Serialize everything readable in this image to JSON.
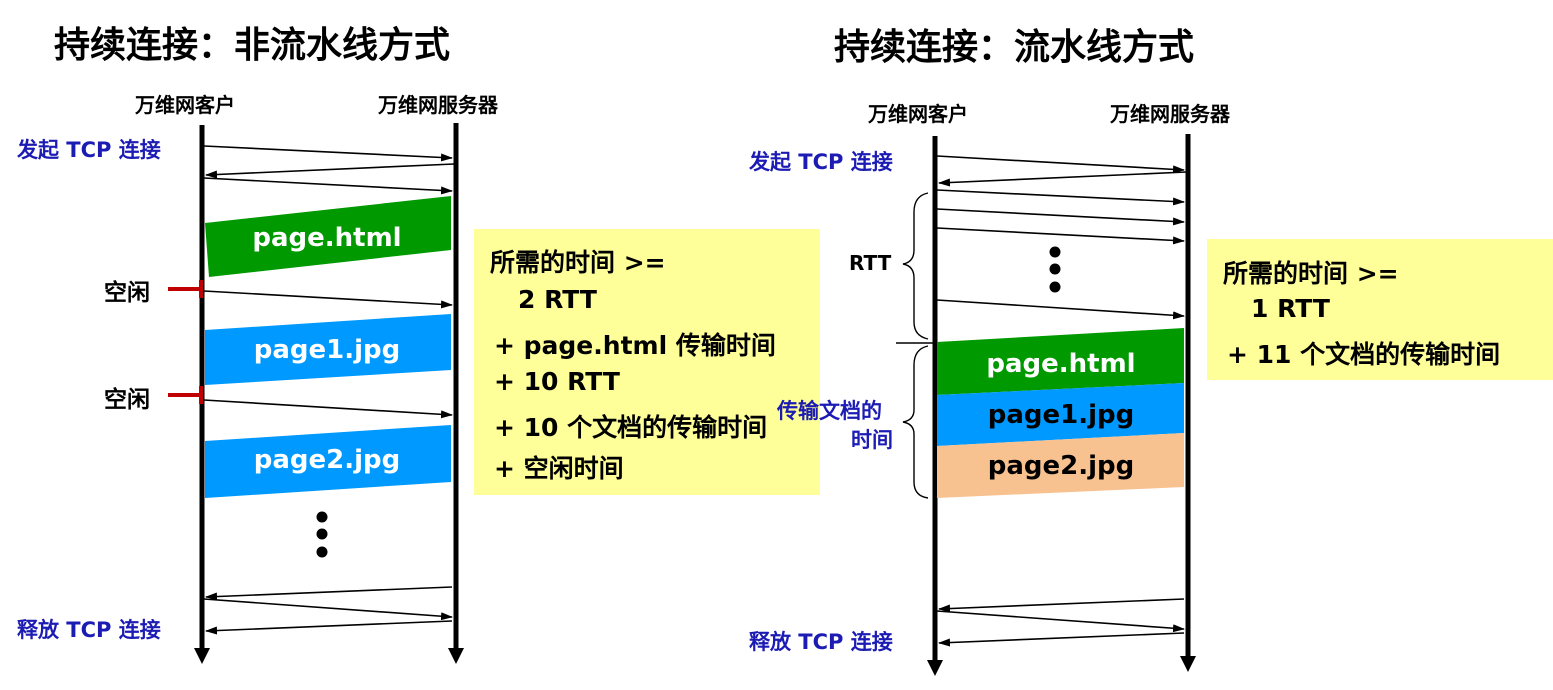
{
  "left": {
    "title": "持续连接：非流水线方式",
    "client_label": "万维网客户",
    "server_label": "万维网服务器",
    "open_tcp": "发起 TCP 连接",
    "close_tcp": "释放 TCP 连接",
    "idle_label_1": "空闲",
    "idle_label_2": "空闲",
    "blocks": [
      "page.html",
      "page1.jpg",
      "page2.jpg"
    ],
    "time_box": [
      "所需的时间 >=",
      "2 RTT",
      "+ page.html 传输时间",
      "+ 10 RTT",
      "+ 10 个文档的传输时间",
      "+ 空闲时间"
    ]
  },
  "right": {
    "title": "持续连接：流水线方式",
    "client_label": "万维网客户",
    "server_label": "万维网服务器",
    "open_tcp": "发起 TCP 连接",
    "close_tcp": "释放 TCP 连接",
    "rtt_label": "RTT",
    "transfer_label_1": "传输文档的",
    "transfer_label_2": "时间",
    "blocks": [
      "page.html",
      "page1.jpg",
      "page2.jpg"
    ],
    "time_box": [
      "所需的时间 >=",
      "1 RTT",
      "+ 11 个文档的传输时间"
    ]
  },
  "colors": {
    "green": "#009900",
    "blue": "#0099ff",
    "peach": "#f8c190",
    "note": "#ffff99",
    "label_blue": "#1c1cb4",
    "idle_red": "#c00000"
  }
}
